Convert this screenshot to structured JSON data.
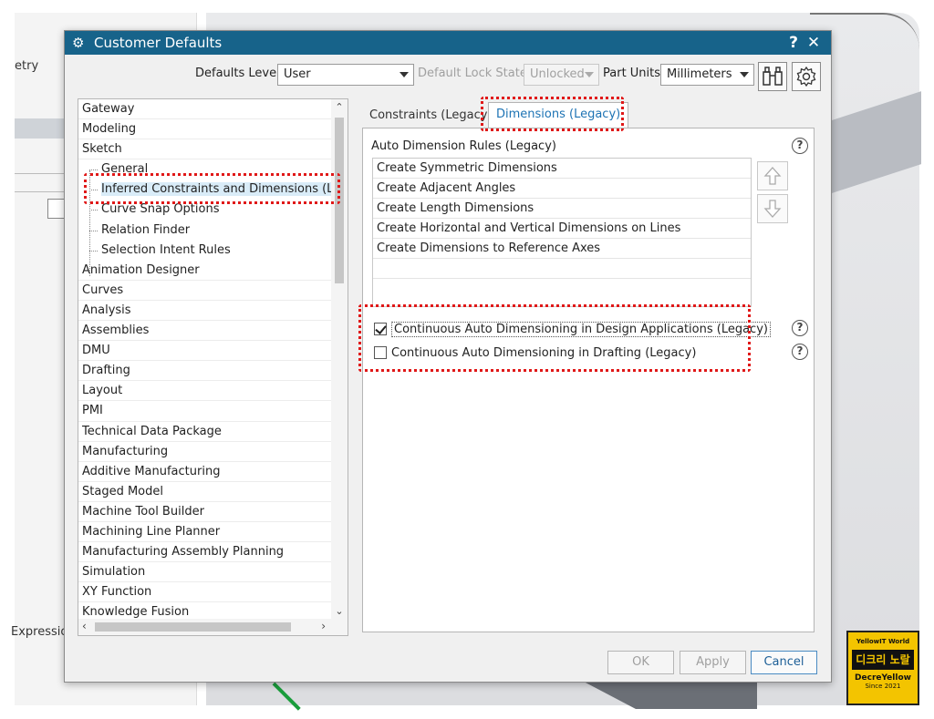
{
  "background": {
    "left_text_1": "etry",
    "left_text_2": "Expressior"
  },
  "dialog": {
    "title": "Customer Defaults",
    "help_button": "?",
    "close_button": "✕"
  },
  "toolbar": {
    "defaults_level_label": "Defaults Level",
    "defaults_level_value": "User",
    "lock_state_label": "Default Lock State",
    "lock_state_value": "Unlocked",
    "part_units_label": "Part Units",
    "part_units_value": "Millimeters",
    "find_icon": "binoculars-icon",
    "settings_icon": "settings-gear-icon"
  },
  "tree": {
    "items": [
      {
        "label": "Gateway",
        "level": 0
      },
      {
        "label": "Modeling",
        "level": 0
      },
      {
        "label": "Sketch",
        "level": 0
      },
      {
        "label": "General",
        "level": 1
      },
      {
        "label": "Inferred Constraints and Dimensions (Lega",
        "level": 1,
        "selected": true
      },
      {
        "label": "Curve Snap Options",
        "level": 1
      },
      {
        "label": "Relation Finder",
        "level": 1
      },
      {
        "label": "Selection Intent Rules",
        "level": 1
      },
      {
        "label": "Animation Designer",
        "level": 0
      },
      {
        "label": "Curves",
        "level": 0
      },
      {
        "label": "Analysis",
        "level": 0
      },
      {
        "label": "Assemblies",
        "level": 0
      },
      {
        "label": "DMU",
        "level": 0
      },
      {
        "label": "Drafting",
        "level": 0
      },
      {
        "label": "Layout",
        "level": 0
      },
      {
        "label": "PMI",
        "level": 0
      },
      {
        "label": "Technical Data Package",
        "level": 0
      },
      {
        "label": "Manufacturing",
        "level": 0
      },
      {
        "label": "Additive Manufacturing",
        "level": 0
      },
      {
        "label": "Staged Model",
        "level": 0
      },
      {
        "label": "Machine Tool Builder",
        "level": 0
      },
      {
        "label": "Machining Line Planner",
        "level": 0
      },
      {
        "label": "Manufacturing Assembly Planning",
        "level": 0
      },
      {
        "label": "Simulation",
        "level": 0
      },
      {
        "label": "XY Function",
        "level": 0
      },
      {
        "label": "Knowledge Fusion",
        "level": 0
      }
    ]
  },
  "tabs": [
    {
      "label": "Constraints (Legacy)",
      "active": false
    },
    {
      "label": "Dimensions (Legacy)",
      "active": true
    }
  ],
  "panel": {
    "section_title": "Auto Dimension Rules (Legacy)",
    "rules": [
      "Create Symmetric Dimensions",
      "Create Adjacent Angles",
      "Create Length Dimensions",
      "Create Horizontal and Vertical Dimensions on Lines",
      "Create Dimensions to Reference Axes"
    ],
    "checkbox_1": {
      "label": "Continuous Auto Dimensioning in Design Applications (Legacy)",
      "checked": true
    },
    "checkbox_2": {
      "label": "Continuous Auto Dimensioning in Drafting (Legacy)",
      "checked": false
    },
    "help_glyph": "?"
  },
  "buttons": {
    "ok": "OK",
    "apply": "Apply",
    "cancel": "Cancel"
  },
  "watermark": {
    "line1": "YellowIT World",
    "line2": "디크리 노랄",
    "line3": "DecreYellow",
    "line4": "Since 2021"
  },
  "colors": {
    "titlebar": "#17638a",
    "highlight": "#e01818",
    "active_tab_text": "#1d73b4"
  }
}
